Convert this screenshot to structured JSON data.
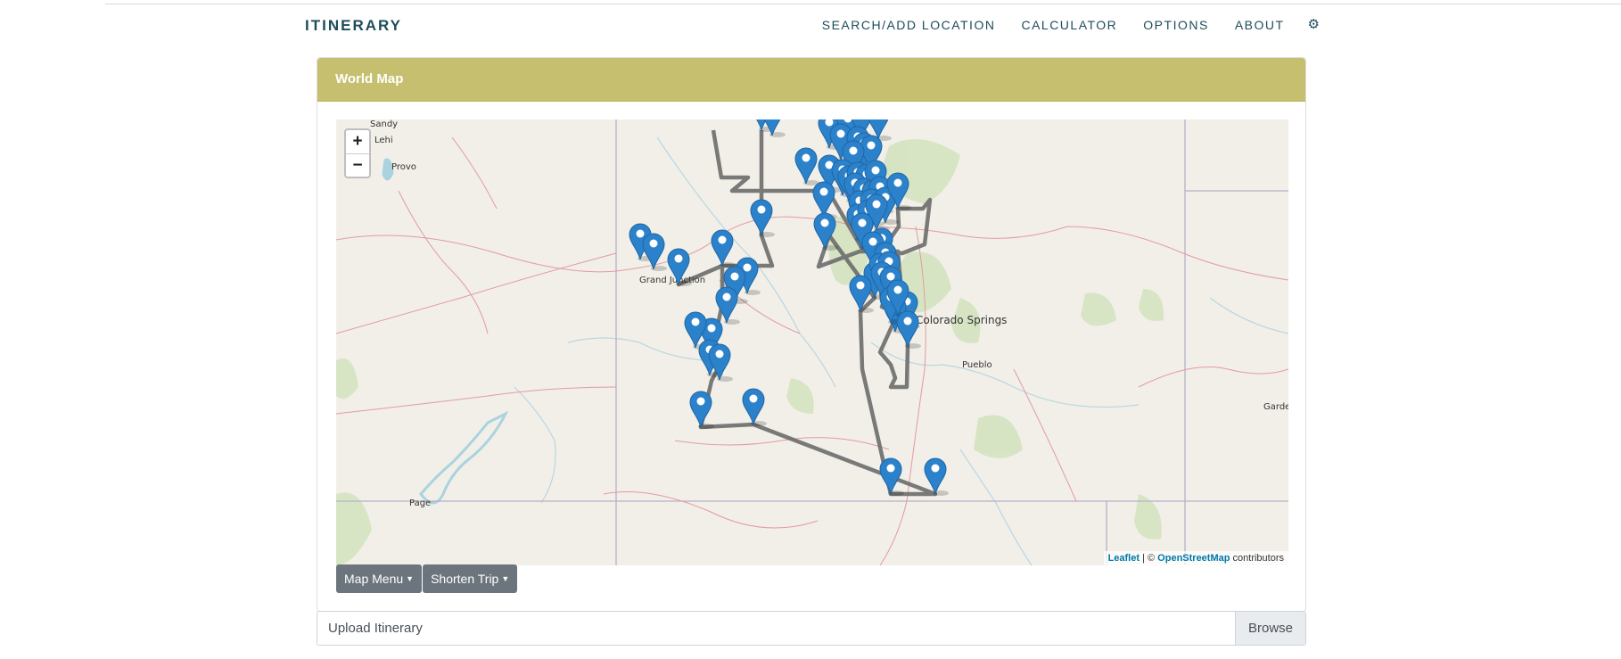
{
  "navbar": {
    "brand": "ITINERARY",
    "links": [
      "SEARCH/ADD LOCATION",
      "CALCULATOR",
      "OPTIONS",
      "ABOUT"
    ],
    "settings_icon": "gear-icon"
  },
  "card": {
    "title": "World Map"
  },
  "map": {
    "zoom_in": "+",
    "zoom_out": "−",
    "attribution": {
      "leaflet": "Leaflet",
      "sep": " | © ",
      "osm": "OpenStreetMap",
      "tail": " contributors"
    },
    "place_labels": [
      "Sandy",
      "Lehi",
      "Provo",
      "Grand Junction",
      "Colorado Springs",
      "Pueblo",
      "Garden City",
      "Page"
    ],
    "route_color": "#6b6b6b",
    "marker_color": "#2b82cb"
  },
  "buttons": {
    "map_menu": "Map Menu",
    "shorten_trip": "Shorten Trip"
  },
  "upload": {
    "label": "Upload Itinerary",
    "browse": "Browse"
  }
}
